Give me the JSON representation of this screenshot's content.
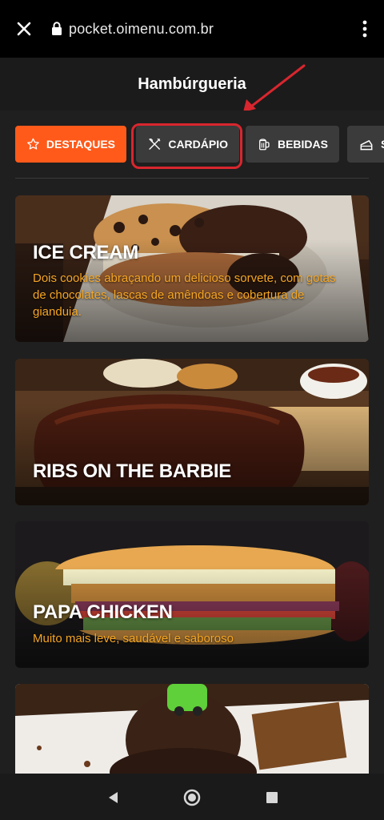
{
  "browser": {
    "url": "pocket.oimenu.com.br"
  },
  "header": {
    "title": "Hambúrgueria"
  },
  "tabs": [
    {
      "label": "DESTAQUES",
      "icon": "star-icon"
    },
    {
      "label": "CARDÁPIO",
      "icon": "cutlery-icon"
    },
    {
      "label": "BEBIDAS",
      "icon": "beer-mug-icon"
    },
    {
      "label": "S",
      "icon": "cake-icon"
    }
  ],
  "cards": [
    {
      "name": "ICE CREAM",
      "description": "Dois cookies abraçando um delicioso sorvete, com gotas de chocolates, lascas de amêndoas e cobertura de gianduia."
    },
    {
      "name": "RIBS ON THE BARBIE",
      "description": ""
    },
    {
      "name": "PAPA CHICKEN",
      "description": "Muito mais leve, saudável e saboroso"
    },
    {
      "name": "",
      "description": ""
    }
  ],
  "colors": {
    "accent": "#ff5a1a",
    "highlight": "#d9262e",
    "description_text": "#f5a623"
  }
}
